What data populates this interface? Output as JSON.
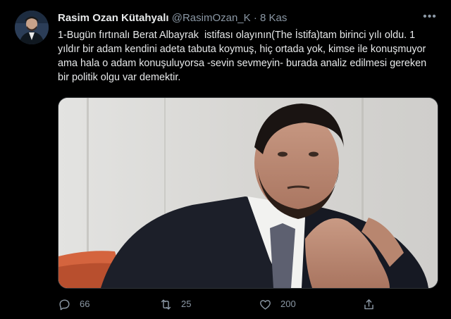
{
  "tweet": {
    "author": {
      "display_name": "Rasim Ozan Kütahyalı",
      "handle": "@RasimOzan_K",
      "separator": "·",
      "date": "8 Kas"
    },
    "text": "1-Bugün fırtınalı Berat Albayrak  istifası olayının(The İstifa)tam birinci yılı oldu. 1 yıldır bir adam kendini adeta tabuta koymuş, hiç ortada yok, kimse ile konuşmuyor ama hala o adam konuşuluyorsa -sevin sevmeyin- burada analiz edilmesi gereken bir politik olgu var demektir.",
    "actions": {
      "reply_count": "66",
      "retweet_count": "25",
      "like_count": "200"
    }
  },
  "icons": {
    "more": "more-icon",
    "reply": "reply-icon",
    "retweet": "retweet-icon",
    "like": "like-icon",
    "share": "share-icon"
  },
  "colors": {
    "background": "#000000",
    "text_primary": "#e7e9ea",
    "text_secondary": "#8b98a5"
  }
}
